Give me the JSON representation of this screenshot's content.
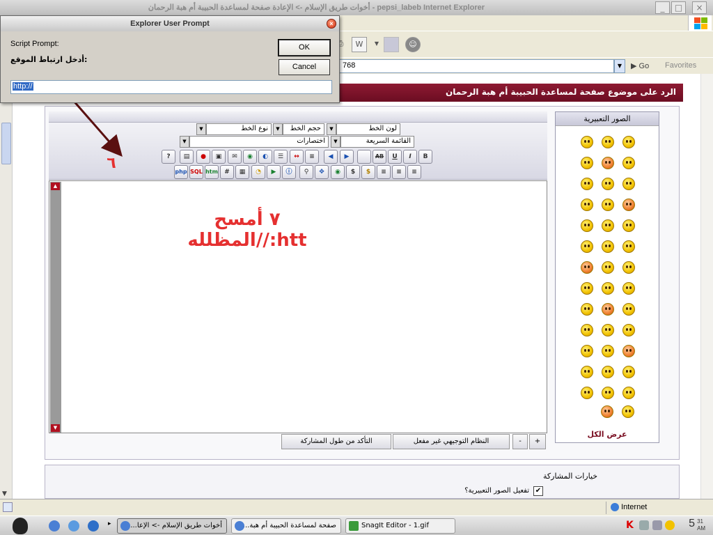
{
  "window": {
    "title": "pepsi_labeb Internet Explorer - أخوات طريق الإسلام -> الإعادة صفحة لمساعدة الحبيبة أم هبة الرحمان",
    "address_fragment": "768",
    "go_label": "Go",
    "favorites_label": "Favorites"
  },
  "dialog": {
    "title": "Explorer User Prompt",
    "script_prompt": "Script Prompt:",
    "prompt_text": "أدخل ارتباط الموقع:",
    "ok_label": "OK",
    "cancel_label": "Cancel",
    "input_value": "http://"
  },
  "page": {
    "header": "الرد على موضوع صفحة لمساعدة الحبيبة أم هبة الرحمان"
  },
  "editor": {
    "font_color": "لون الخط",
    "font_size": "حجم الخط",
    "font_type": "نوع الخط",
    "quick_list": "القائمة السريعة",
    "shortcuts": "اختصارات",
    "row1_buttons": [
      "B",
      "I",
      "U",
      "AB",
      "",
      "",
      "",
      "",
      "",
      "",
      "",
      "",
      "",
      "",
      "",
      "",
      "",
      "?"
    ],
    "row2_buttons": [
      "",
      "",
      "",
      "$",
      "",
      "",
      "",
      "",
      "",
      "",
      "",
      "",
      "#",
      "htm",
      "SQL",
      "php"
    ],
    "bottom_buttons": {
      "plus": "+",
      "minus": "-",
      "guide": "النظام التوجيهي غير مفعل",
      "check_length": "التأكد من طول المشاركة"
    }
  },
  "annotation": {
    "step6": "٦",
    "step7_line1": "٧ أمسح",
    "step7_line2": "المظلله//:htt"
  },
  "smilies": {
    "title": "الصور التعبيرية",
    "show_all": "عرض الكل",
    "count": 41
  },
  "options": {
    "title": "خيارات المشاركة",
    "enable_smilies": "تفعيل الصور التعبيرية؟",
    "enable_smilies_checked": true
  },
  "statusbar": {
    "zone": "Internet"
  },
  "taskbar": {
    "tasks": [
      "أخوات طريق الإسلام -> الإعا...",
      "صفحة لمساعدة الحبيبة أم هبة...",
      "SnagIt Editor - 1.gif"
    ],
    "clock": "5",
    "clock_min": "31",
    "clock_ampm": "AM"
  },
  "colors": {
    "header_bg": "#8e1a32",
    "annotation": "#e53030",
    "dialog_bg": "#d4d0c8"
  }
}
